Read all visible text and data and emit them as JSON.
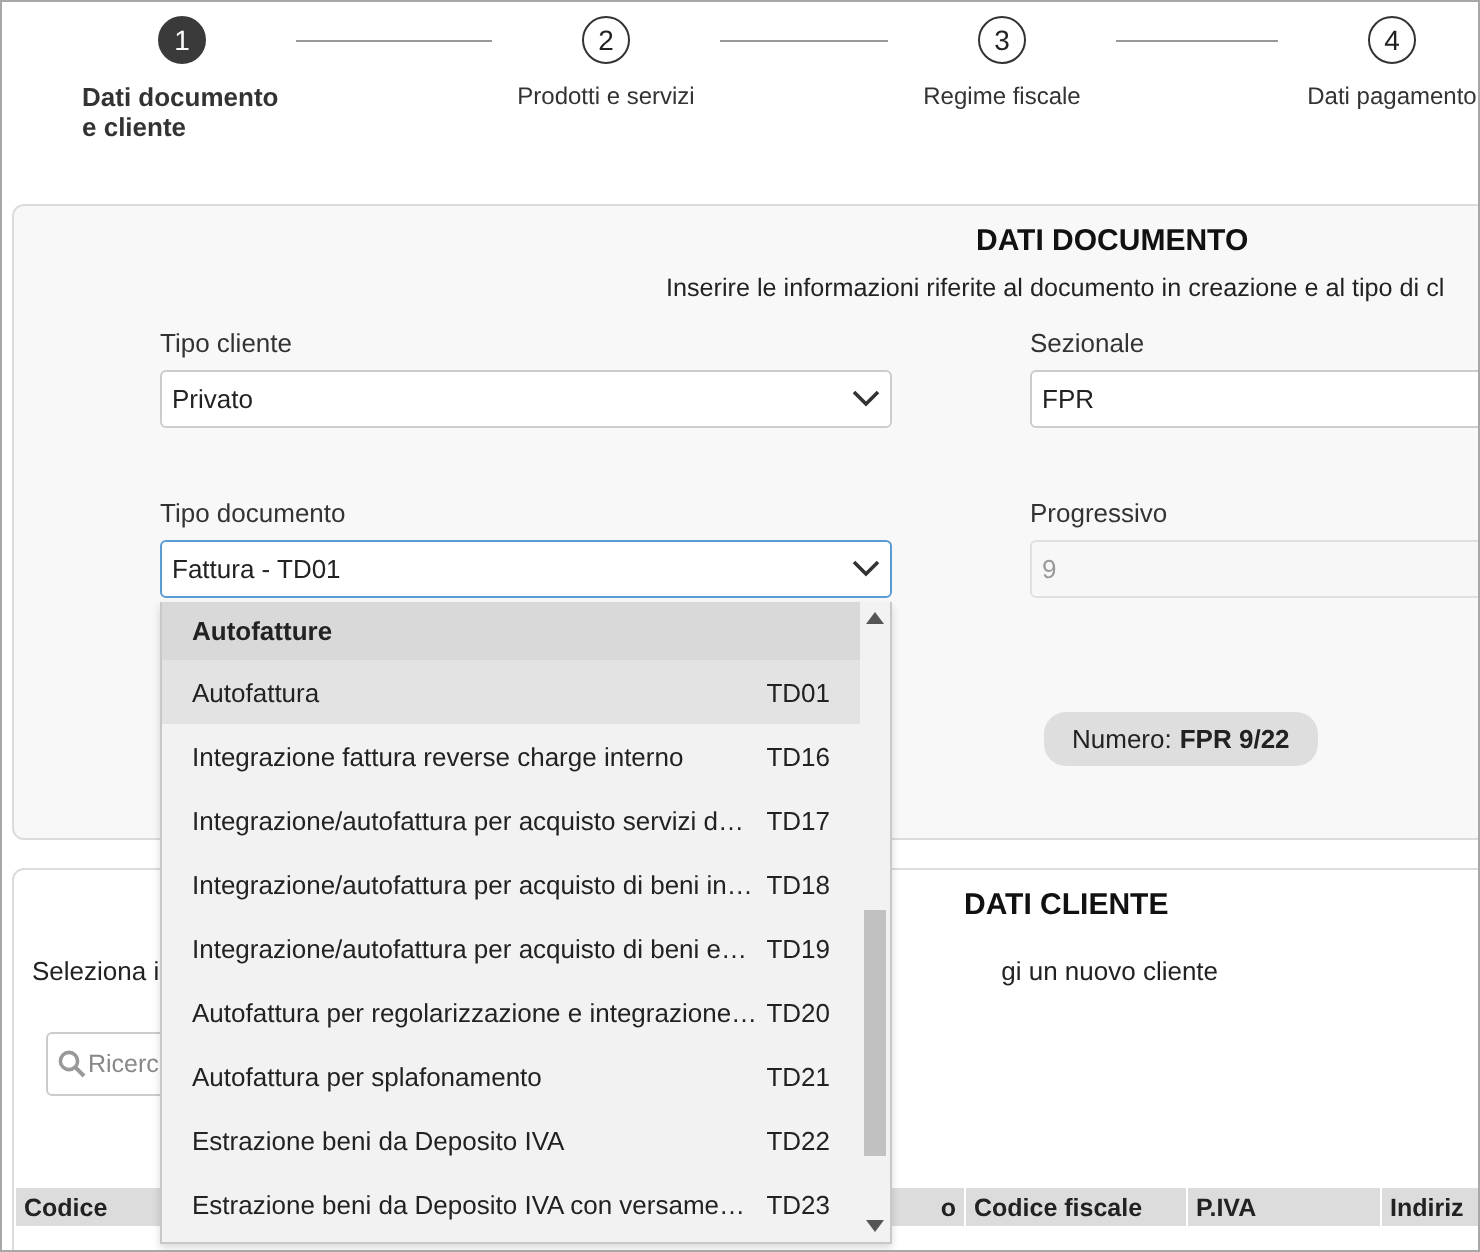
{
  "steps": [
    {
      "number": "1",
      "label": "Dati documento e cliente",
      "selected": true
    },
    {
      "number": "2",
      "label": "Prodotti e servizi",
      "selected": false
    },
    {
      "number": "3",
      "label": "Regime fiscale",
      "selected": false
    },
    {
      "number": "4",
      "label": "Dati pagamento",
      "selected": false
    }
  ],
  "documento": {
    "title": "DATI DOCUMENTO",
    "subtitle": "Inserire le informazioni riferite al documento in creazione e al tipo di cl",
    "tipo_cliente": {
      "label": "Tipo cliente",
      "value": "Privato"
    },
    "sezionale": {
      "label": "Sezionale",
      "value": "FPR"
    },
    "tipo_documento": {
      "label": "Tipo documento",
      "value": "Fattura - TD01",
      "expanded": true
    },
    "progressivo": {
      "label": "Progressivo",
      "value": "9",
      "disabled": true
    },
    "numero": {
      "label": "Numero:",
      "value": "FPR 9/22"
    }
  },
  "cliente": {
    "title": "DATI CLIENTE",
    "text_left": "Seleziona i",
    "text_right": "gi un nuovo cliente",
    "search": {
      "placeholder": "Ricerc"
    },
    "table": {
      "columns": [
        "Codice",
        "",
        "",
        "o",
        "Codice fiscale",
        "P.IVA",
        "Indiriz"
      ]
    }
  },
  "dropdown": {
    "items": [
      {
        "kind": "group",
        "text": "Autofatture"
      },
      {
        "kind": "option",
        "text": "Autofattura",
        "code": "TD01",
        "selected": true
      },
      {
        "kind": "option",
        "text": "Integrazione fattura reverse charge interno",
        "code": "TD16",
        "selected": false
      },
      {
        "kind": "option",
        "text": "Integrazione/autofattura per acquisto servizi d…",
        "code": "TD17",
        "selected": false
      },
      {
        "kind": "option",
        "text": "Integrazione/autofattura per acquisto di beni in…",
        "code": "TD18",
        "selected": false
      },
      {
        "kind": "option",
        "text": "Integrazione/autofattura per acquisto di beni e…",
        "code": "TD19",
        "selected": false
      },
      {
        "kind": "option",
        "text": "Autofattura per regolarizzazione e integrazione…",
        "code": "TD20",
        "selected": false
      },
      {
        "kind": "option",
        "text": "Autofattura per splafonamento",
        "code": "TD21",
        "selected": false
      },
      {
        "kind": "option",
        "text": "Estrazione beni da Deposito IVA",
        "code": "TD22",
        "selected": false
      },
      {
        "kind": "option",
        "text": "Estrazione beni da Deposito IVA con versame…",
        "code": "TD23",
        "selected": false
      }
    ]
  }
}
